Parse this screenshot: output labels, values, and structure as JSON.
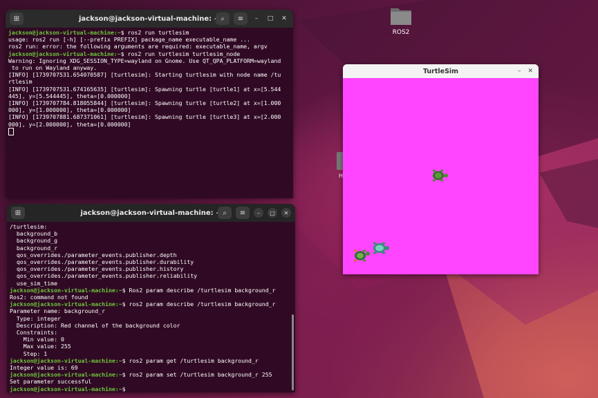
{
  "desktop": {
    "folder_label": "ROS2",
    "partial_label": "H"
  },
  "terminal_top": {
    "title": "jackson@jackson-virtual-machine: ~",
    "lines": [
      {
        "prompt": "jackson@jackson-virtual-machine:~",
        "text": "$ ros2 run turtlesim"
      },
      {
        "prompt": "",
        "text": "usage: ros2 run [-h] [--prefix PREFIX] package_name executable_name ..."
      },
      {
        "prompt": "",
        "text": "ros2 run: error: the following arguments are required: executable_name, argv"
      },
      {
        "prompt": "jackson@jackson-virtual-machine:~",
        "text": "$ ros2 run turtlesim turtlesim_node"
      },
      {
        "prompt": "",
        "text": "Warning: Ignoring XDG_SESSION_TYPE=wayland on Gnome. Use QT_QPA_PLATFORM=wayland"
      },
      {
        "prompt": "",
        "text": " to run on Wayland anyway."
      },
      {
        "prompt": "",
        "text": "[INFO] [1739707531.654070587] [turtlesim]: Starting turtlesim with node name /tu"
      },
      {
        "prompt": "",
        "text": "rtlesim"
      },
      {
        "prompt": "",
        "text": "[INFO] [1739707531.674165635] [turtlesim]: Spawning turtle [turtle1] at x=[5.544"
      },
      {
        "prompt": "",
        "text": "445], y=[5.544445], theta=[0.000000]"
      },
      {
        "prompt": "",
        "text": "[INFO] [1739707784.818055844] [turtlesim]: Spawning turtle [turtle2] at x=[1.000"
      },
      {
        "prompt": "",
        "text": "000], y=[1.000000], theta=[0.000000]"
      },
      {
        "prompt": "",
        "text": "[INFO] [1739707881.687371061] [turtlesim]: Spawning turtle [turtle3] at x=[2.000"
      },
      {
        "prompt": "",
        "text": "000], y=[2.000000], theta=[0.000000]"
      }
    ]
  },
  "terminal_bottom": {
    "title": "jackson@jackson-virtual-machine: ~",
    "lines": [
      {
        "prompt": "",
        "text": "/turtlesim:"
      },
      {
        "prompt": "",
        "text": "  background_b"
      },
      {
        "prompt": "",
        "text": "  background_g"
      },
      {
        "prompt": "",
        "text": "  background_r"
      },
      {
        "prompt": "",
        "text": "  qos_overrides./parameter_events.publisher.depth"
      },
      {
        "prompt": "",
        "text": "  qos_overrides./parameter_events.publisher.durability"
      },
      {
        "prompt": "",
        "text": "  qos_overrides./parameter_events.publisher.history"
      },
      {
        "prompt": "",
        "text": "  qos_overrides./parameter_events.publisher.reliability"
      },
      {
        "prompt": "",
        "text": "  use_sim_time"
      },
      {
        "prompt": "jackson@jackson-virtual-machine:~",
        "text": "$ Ros2 param describe /turtlesim background_r"
      },
      {
        "prompt": "",
        "text": "Ros2: command not found"
      },
      {
        "prompt": "jackson@jackson-virtual-machine:~",
        "text": "$ ros2 param describe /turtlesim background_r"
      },
      {
        "prompt": "",
        "text": "Parameter name: background_r"
      },
      {
        "prompt": "",
        "text": "  Type: integer"
      },
      {
        "prompt": "",
        "text": "  Description: Red channel of the background color"
      },
      {
        "prompt": "",
        "text": "  Constraints:"
      },
      {
        "prompt": "",
        "text": "    Min value: 0"
      },
      {
        "prompt": "",
        "text": "    Max value: 255"
      },
      {
        "prompt": "",
        "text": "    Step: 1"
      },
      {
        "prompt": "jackson@jackson-virtual-machine:~",
        "text": "$ ros2 param get /turtlesim background_r"
      },
      {
        "prompt": "",
        "text": "Integer value is: 69"
      },
      {
        "prompt": "jackson@jackson-virtual-machine:~",
        "text": "$ ros2 param set /turtlesim background_r 255"
      },
      {
        "prompt": "",
        "text": "Set parameter successful"
      },
      {
        "prompt": "jackson@jackson-virtual-machine:~",
        "text": "$ "
      }
    ]
  },
  "turtlesim": {
    "title": "TurtleSim",
    "background_color": "#ff45ff"
  },
  "icons": {
    "new_tab": "new-tab-icon",
    "search": "search-icon",
    "menu": "hamburger-menu-icon",
    "minimize": "minimize-icon",
    "maximize": "maximize-icon",
    "close": "close-icon"
  }
}
